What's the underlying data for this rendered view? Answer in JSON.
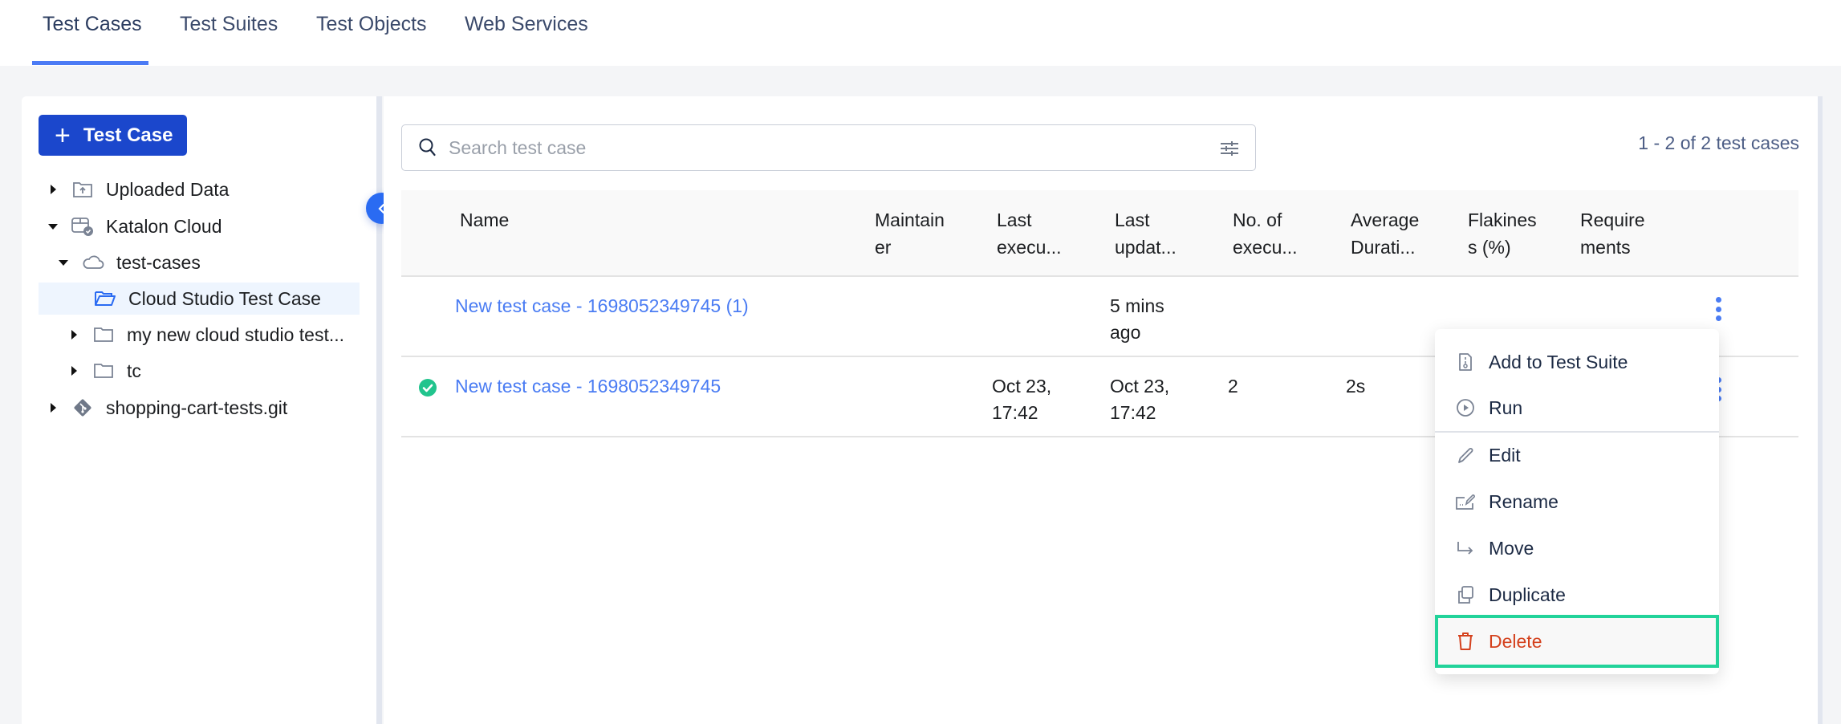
{
  "tabs": [
    {
      "label": "Test Cases",
      "active": true
    },
    {
      "label": "Test Suites",
      "active": false
    },
    {
      "label": "Test Objects",
      "active": false
    },
    {
      "label": "Web Services",
      "active": false
    }
  ],
  "sidebar": {
    "add_button": "Test Case",
    "tree": [
      {
        "label": "Uploaded Data",
        "icon": "folder-upload-icon",
        "expanded": false
      },
      {
        "label": "Katalon Cloud",
        "icon": "cloud-storage-icon",
        "expanded": true
      },
      {
        "label": "test-cases",
        "icon": "cloud-icon",
        "expanded": true
      },
      {
        "label": "Cloud Studio Test Case",
        "icon": "folder-open-icon",
        "selected": true
      },
      {
        "label": "my new cloud studio test...",
        "icon": "folder-icon",
        "expanded": false
      },
      {
        "label": "tc",
        "icon": "folder-icon",
        "expanded": false
      },
      {
        "label": "shopping-cart-tests.git",
        "icon": "git-icon",
        "expanded": false
      }
    ]
  },
  "search": {
    "placeholder": "Search test case",
    "value": ""
  },
  "count_label": "1 - 2 of 2 test cases",
  "table": {
    "columns": [
      {
        "line1": "Name",
        "line2": ""
      },
      {
        "line1": "Maintain",
        "line2": "er"
      },
      {
        "line1": "Last",
        "line2": "execu..."
      },
      {
        "line1": "Last",
        "line2": "updat..."
      },
      {
        "line1": "No. of",
        "line2": "execu..."
      },
      {
        "line1": "Average",
        "line2": "Durati..."
      },
      {
        "line1": "Flakines",
        "line2": "s (%)"
      },
      {
        "line1": "Require",
        "line2": "ments"
      }
    ],
    "rows": [
      {
        "status": "",
        "name": "New test case - 1698052349745 (1)",
        "maintainer": "",
        "last_exec_1": "",
        "last_exec_2": "",
        "last_upd_1": "5 mins",
        "last_upd_2": "ago",
        "executions": "",
        "avg_duration": "",
        "flakiness": "",
        "requirements": ""
      },
      {
        "status": "passed",
        "name": "New test case - 1698052349745",
        "maintainer": "",
        "last_exec_1": "Oct 23,",
        "last_exec_2": "17:42",
        "last_upd_1": "Oct 23,",
        "last_upd_2": "17:42",
        "executions": "2",
        "avg_duration": "2s",
        "flakiness": "",
        "requirements": ""
      }
    ]
  },
  "context_menu": {
    "items": [
      {
        "label": "Add to Test Suite",
        "icon": "test-suite-icon"
      },
      {
        "label": "Run",
        "icon": "play-circle-icon"
      },
      {
        "label": "Edit",
        "icon": "pencil-icon"
      },
      {
        "label": "Rename",
        "icon": "rename-icon"
      },
      {
        "label": "Move",
        "icon": "move-arrow-icon"
      },
      {
        "label": "Duplicate",
        "icon": "duplicate-icon"
      },
      {
        "label": "Delete",
        "icon": "trash-icon",
        "highlighted": true
      }
    ]
  },
  "colors": {
    "primary": "#1b47cc",
    "accent": "#2a6bf2",
    "link": "#4a7cf3",
    "success": "#21c48d",
    "danger": "#d4411d",
    "highlight_border": "#22d39a"
  }
}
